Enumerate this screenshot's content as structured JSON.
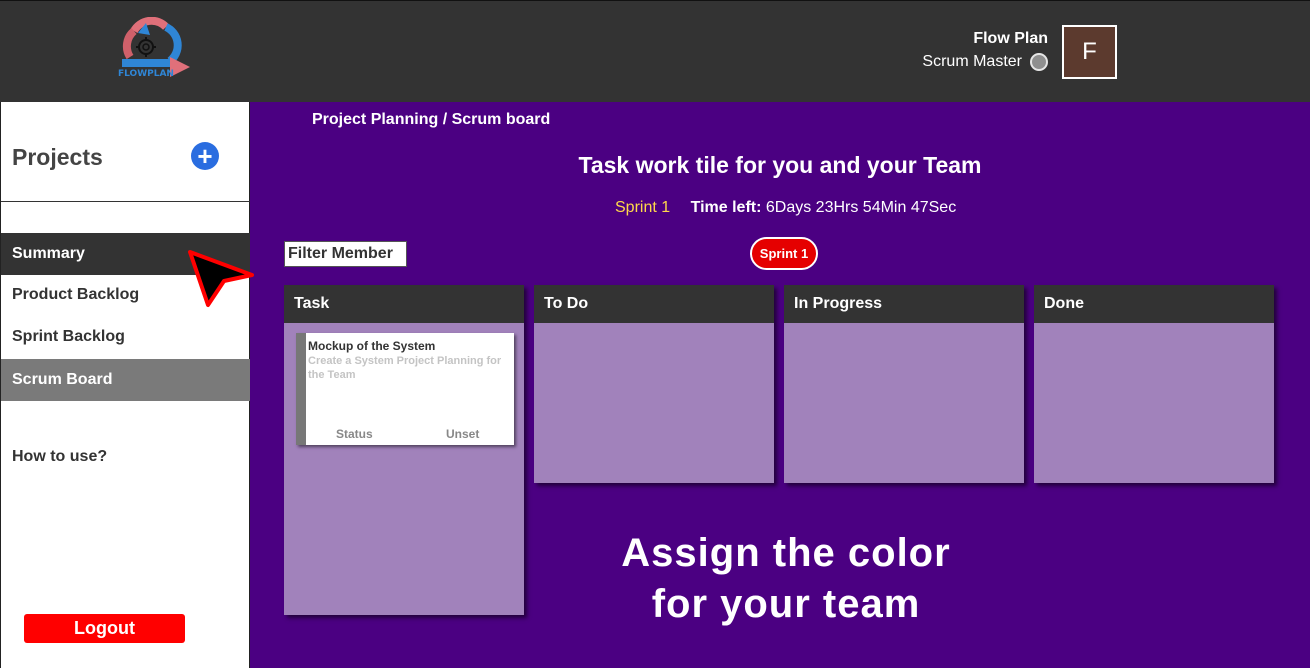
{
  "header": {
    "logo_text": "FLOWPLAN",
    "user_name": "Flow Plan",
    "user_role": "Scrum Master",
    "avatar_initial": "F"
  },
  "sidebar": {
    "projects_title": "Projects",
    "add_icon": "plus-circle-icon",
    "items": [
      {
        "label": "Summary"
      },
      {
        "label": "Product Backlog"
      },
      {
        "label": "Sprint Backlog"
      },
      {
        "label": "Scrum Board"
      }
    ],
    "how_to": "How to use?",
    "logout_label": "Logout"
  },
  "main": {
    "breadcrumb": "Project Planning / Scrum board",
    "title": "Task work tile for you and your Team",
    "sprint_label": "Sprint 1",
    "time_left_label": "Time left:",
    "time_left_value": "6Days 23Hrs 54Min 47Sec",
    "filter_label": "Filter Member",
    "sprint_badge": "Sprint 1",
    "columns": [
      {
        "title": "Task"
      },
      {
        "title": "To Do"
      },
      {
        "title": "In Progress"
      },
      {
        "title": "Done"
      }
    ],
    "card": {
      "title": "Mockup of the System",
      "description": "Create a System Project Planning for the Team",
      "status_label": "Status",
      "status_value": "Unset"
    },
    "promo_line1": "Assign the color",
    "promo_line2": "for your team"
  },
  "colors": {
    "background": "#4b0082",
    "header": "#333333",
    "column_body": "#a182bb",
    "accent_red": "#ff0000",
    "sprint_yellow": "#ffd84a",
    "add_blue": "#2a6de0"
  }
}
